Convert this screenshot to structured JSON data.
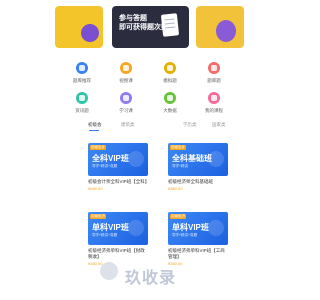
{
  "banners": {
    "left_text": "",
    "center_title_line1": "参与答题",
    "center_title_line2": "即可获得题次数",
    "right_text": ""
  },
  "grid": [
    {
      "label": "题库推荐",
      "color": "#3b82f6",
      "icon": "book-icon"
    },
    {
      "label": "视频课",
      "color": "#f5a623",
      "icon": "video-icon"
    },
    {
      "label": "模拟题",
      "color": "#e0b100",
      "icon": "exam-icon"
    },
    {
      "label": "题库题",
      "color": "#f56c6c",
      "icon": "question-icon"
    },
    {
      "label": "资讯题",
      "color": "#2ec4a6",
      "icon": "news-icon"
    },
    {
      "label": "学习课",
      "color": "#8c7cf0",
      "icon": "study-icon"
    },
    {
      "label": "大数据",
      "color": "#67c23a",
      "icon": "data-icon"
    },
    {
      "label": "我的课程",
      "color": "#f56c9a",
      "icon": "my-course-icon"
    }
  ],
  "tabs": [
    "初级会",
    "建筑类",
    "",
    "学历类",
    "国家类"
  ],
  "cards": [
    {
      "badge": "初级会计",
      "title": "全科VIP班",
      "sub": "导学+精讲+真题",
      "name": "初级会计师全科VIP班【全科】",
      "price": "¥680.00"
    },
    {
      "badge": "初级会计",
      "title": "全科基础班",
      "sub": "导学+精讲",
      "name": "初级经济师全科基础班",
      "price": "¥380.00"
    },
    {
      "badge": "初级经济",
      "title": "单科VIP班",
      "sub": "导学+精讲+真题",
      "name": "初级经济师单科VIP班【财政税收】",
      "price": "¥380.00"
    },
    {
      "badge": "初级经济",
      "title": "单科VIP班",
      "sub": "导学+精讲+真题",
      "name": "初级经济师单科VIP班【工商管理】",
      "price": "¥380.00"
    }
  ],
  "watermark": "玖收录"
}
